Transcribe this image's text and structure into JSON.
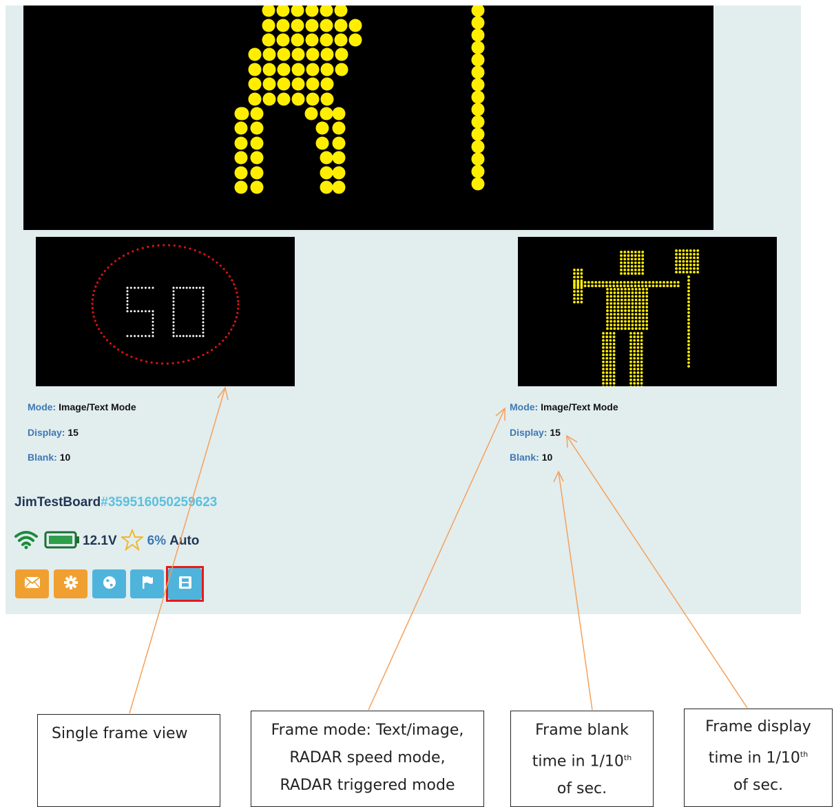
{
  "frames": [
    {
      "mode_label": "Mode:",
      "mode_value": "Image/Text Mode",
      "display_label": "Display:",
      "display_value": "15",
      "blank_label": "Blank:",
      "blank_value": "10"
    },
    {
      "mode_label": "Mode:",
      "mode_value": "Image/Text Mode",
      "display_label": "Display:",
      "display_value": "15",
      "blank_label": "Blank:",
      "blank_value": "10"
    }
  ],
  "speed_sign_number": "50",
  "board": {
    "name": "JimTestBoard",
    "id": "#359516050259623"
  },
  "status": {
    "voltage": "12.1V",
    "percent": "6%",
    "mode": "Auto",
    "wifi_icon": "wifi-icon",
    "battery_icon": "battery-icon",
    "star_icon": "star-icon"
  },
  "buttons": [
    {
      "icon": "envelope-icon",
      "color": "#f0a030"
    },
    {
      "icon": "gear-icon",
      "color": "#f0a030"
    },
    {
      "icon": "globe-icon",
      "color": "#4fb4dc"
    },
    {
      "icon": "flag-icon",
      "color": "#4fb4dc"
    },
    {
      "icon": "film-icon",
      "color": "#4fb4dc",
      "highlighted": true
    }
  ],
  "callouts": {
    "single_frame": "Single frame view",
    "mode_line1": "Frame mode: Text/image,",
    "mode_line2": "RADAR speed mode,",
    "mode_line3": "RADAR triggered mode",
    "blank_line1": "Frame blank",
    "blank_line2": "time in 1/10",
    "blank_line3": "of sec.",
    "display_line1": "Frame display",
    "display_line2": "time in 1/10",
    "display_line3": "of sec.",
    "superscript": "th"
  },
  "colors": {
    "led_yellow": "#ffee00",
    "led_red": "#dd1111",
    "led_white": "#ffffff",
    "panel_bg": "#e2edee",
    "arrow": "#f5a05a",
    "highlight": "#e61a1a"
  }
}
